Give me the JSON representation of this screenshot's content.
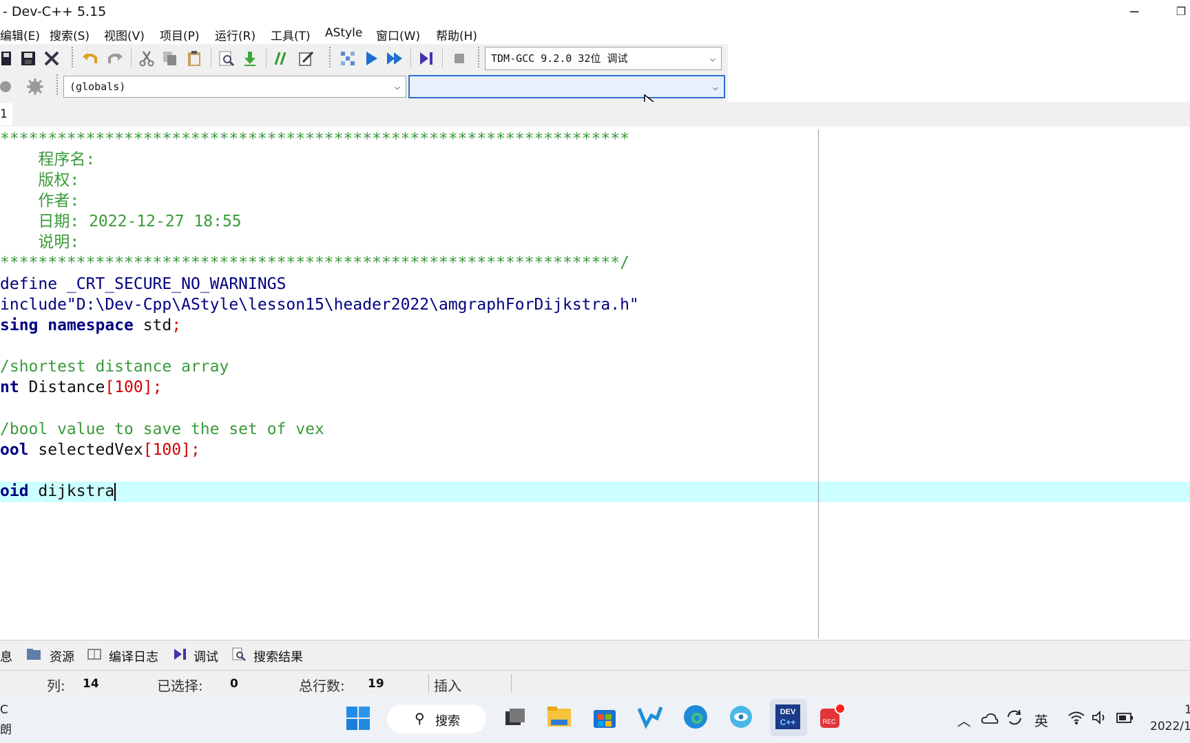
{
  "window": {
    "title": "- Dev-C++ 5.15",
    "minimize_glyph": "─",
    "restore_glyph": "❐"
  },
  "menu": [
    "编辑(E)",
    "搜索(S)",
    "视图(V)",
    "项目(P)",
    "运行(R)",
    "工具(T)",
    "AStyle",
    "窗口(W)",
    "帮助(H)"
  ],
  "toolbar": {
    "compiler_select": "TDM-GCC 9.2.0 32位 调试",
    "scope_select": "(globals)",
    "function_select": ""
  },
  "tabs": {
    "file_tab": "1"
  },
  "code_lines": [
    {
      "text": "******************************************************************"
    },
    {
      "text": "    程序名:"
    },
    {
      "text": "    版权:"
    },
    {
      "text": "    作者:"
    },
    {
      "text": "    日期: 2022-12-27 18:55"
    },
    {
      "text": "    说明:"
    },
    {
      "text": "*****************************************************************/"
    },
    {
      "a": "define _CRT_SECURE_NO_WARNINGS"
    },
    {
      "a": "include\"D:\\Dev-Cpp\\AStyle\\lesson15\\header2022\\amgraphForDijkstra.h\""
    },
    {
      "kw1": "sing",
      "kw2": "namespace",
      "rest": " std",
      "semi": ";"
    },
    {
      "text": ""
    },
    {
      "cm": "/shortest distance array"
    },
    {
      "kw": "nt",
      "rest": " Distance",
      "br1": "[",
      "num": "100",
      "br2": "]",
      "semi": ";"
    },
    {
      "text": ""
    },
    {
      "cm": "/bool value to save the set of vex"
    },
    {
      "kw": "ool",
      "rest": " selectedVex",
      "br1": "[",
      "num": "100",
      "br2": "]",
      "semi": ";"
    },
    {
      "text": ""
    },
    {
      "kw": "oid",
      "rest": " dijkstra"
    }
  ],
  "bottom_tabs": [
    "息",
    "资源",
    "编译日志",
    "调试",
    "搜索结果"
  ],
  "status": {
    "col_label": "列:",
    "col_value": "14",
    "sel_label": "已选择:",
    "sel_value": "0",
    "lines_label": "总行数:",
    "lines_value": "19",
    "mode": "插入"
  },
  "taskbar": {
    "left_top": "C",
    "left_bottom": "朗",
    "search_label": "搜索",
    "ime": "英",
    "clock_top": "1",
    "clock_bottom": "2022/1"
  },
  "icons": [
    "save-icon",
    "save-all-icon",
    "close-icon",
    "undo-icon",
    "redo-icon",
    "cut-icon",
    "copy-icon",
    "paste-icon",
    "find-icon",
    "goto-icon",
    "comment-icon",
    "edit-icon",
    "compile-icon",
    "run-icon",
    "compile-run-icon",
    "debug-icon",
    "stop-icon",
    "class-icon",
    "gear-icon"
  ]
}
